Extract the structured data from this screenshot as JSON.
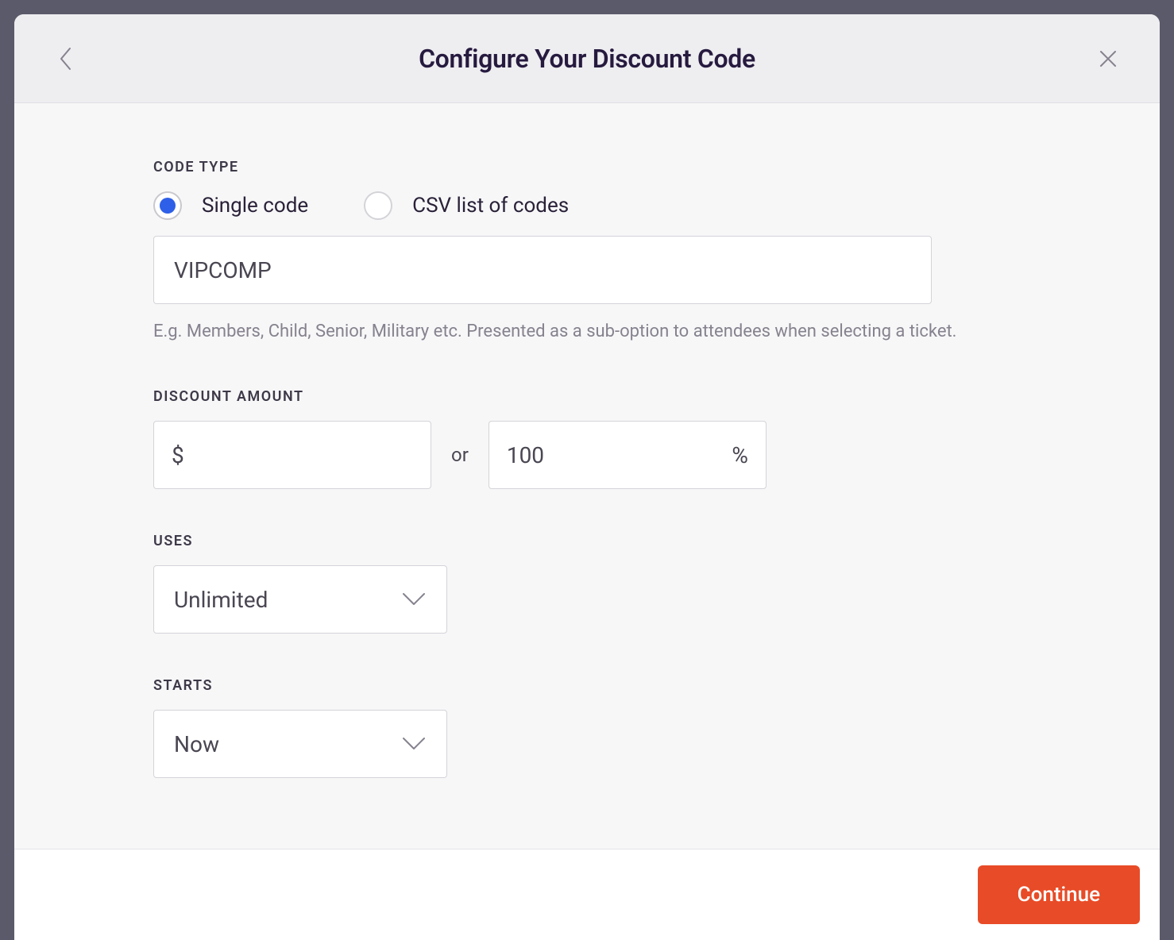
{
  "header": {
    "title": "Configure Your Discount Code"
  },
  "codeType": {
    "label": "CODE TYPE",
    "options": {
      "single": "Single code",
      "csv": "CSV list of codes"
    },
    "value": "VIPCOMP",
    "helper": "E.g. Members, Child, Senior, Military etc. Presented as a sub-option to attendees when selecting a ticket."
  },
  "discountAmount": {
    "label": "DISCOUNT AMOUNT",
    "dollarPrefix": "$",
    "dollarValue": "",
    "orLabel": "or",
    "percentValue": "100",
    "percentSuffix": "%"
  },
  "uses": {
    "label": "USES",
    "value": "Unlimited"
  },
  "starts": {
    "label": "STARTS",
    "value": "Now"
  },
  "footer": {
    "continueLabel": "Continue"
  }
}
